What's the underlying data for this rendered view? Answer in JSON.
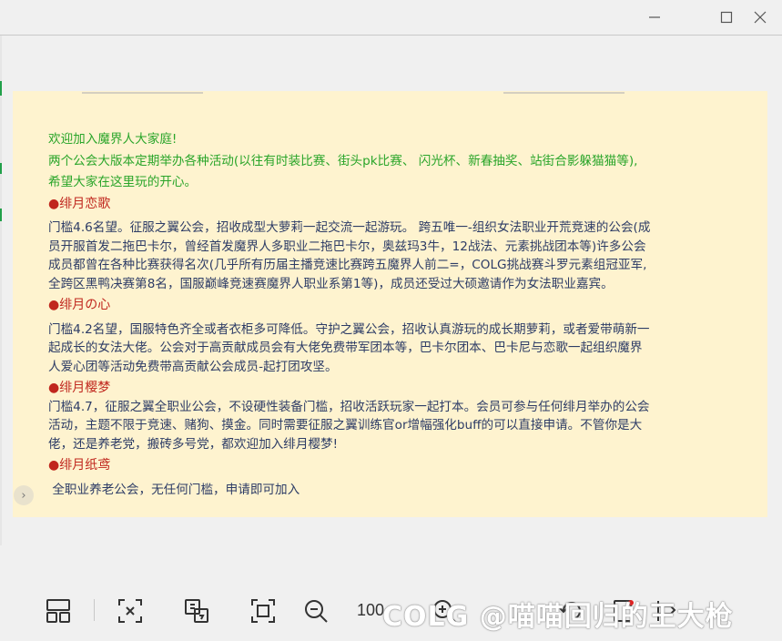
{
  "window": {
    "controls": [
      "minimize",
      "maximize",
      "close"
    ]
  },
  "intro": {
    "line1": "欢迎加入魔界人大家庭!",
    "line2": "两个公会大版本定期举办各种活动(以往有时装比赛、街头pk比赛、 闪光杯、新春抽奖、站街合影躲猫猫等),",
    "line3": "希望大家在这里玩的开心。"
  },
  "guilds": [
    {
      "title": "●绯月恋歌",
      "lines": [
        "门槛4.6名望。征服之翼公会，招收成型大萝莉一起交流一起游玩。 跨五唯一-组织女法职业开荒竞速的公会(成",
        "员开服首发二拖巴卡尔，曾经首发魔界人多职业二拖巴卡尔，奥兹玛3牛，12战法、元素挑战团本等)许多公会",
        "成员都曾在各种比赛获得名次(几乎所有历届主播竞速比赛跨五魔界人前二=，COLG挑战赛斗罗元素组冠亚军,",
        "全跨区黑鸭决赛第8名，国服巅峰竞速赛魔界人职业系第1等)，成员还受过大硕邀请作为女法职业嘉宾。"
      ]
    },
    {
      "title": "●绯月の心",
      "lines": [
        "门槛4.2名望，国服特色齐全或者衣柜多可降低。守护之翼公会，招收认真游玩的成长期萝莉，或者爱带萌新一",
        "起成长的女法大佬。公会对于高贡献成员会有大佬免费带军团本等，巴卡尔团本、巴卡尼与恋歌一起组织魔界",
        "人爱心团等活动免费带高贡献公会成员-起打团攻坚。"
      ]
    },
    {
      "title": "●绯月樱梦",
      "lines": [
        "门槛4.7，征服之翼全职业公会，不设硬性装备门槛，招收活跃玩家一起打本。会员可参与任何绯月举办的公会",
        "活动，主题不限于竞速、赌狗、摸金。同时需要征服之翼训练官or增幅强化buff的可以直接申请。不管你是大",
        "佬，还是养老党，搬砖多号党，都欢迎加入绯月樱梦!"
      ]
    },
    {
      "title": "●绯月纸鸢",
      "lines": [
        " 全职业养老公会，无任何门槛，申请即可加入"
      ]
    }
  ],
  "toolbar": {
    "zoom_value": "100",
    "watermark": "COLG @喵喵回归的王大枪"
  },
  "colors": {
    "canvas_bg": "#fef3cf",
    "green_text": "#2aa52a",
    "red_heading": "#c0271e",
    "body_text": "#2d3c66"
  }
}
